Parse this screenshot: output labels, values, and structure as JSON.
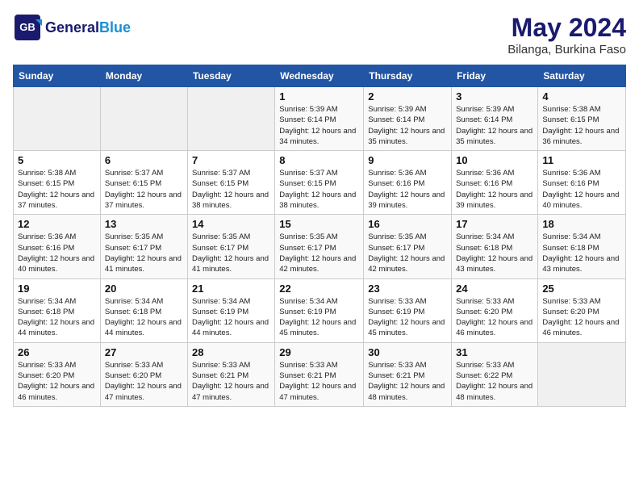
{
  "header": {
    "logo_general": "General",
    "logo_blue": "Blue",
    "month": "May 2024",
    "location": "Bilanga, Burkina Faso"
  },
  "weekdays": [
    "Sunday",
    "Monday",
    "Tuesday",
    "Wednesday",
    "Thursday",
    "Friday",
    "Saturday"
  ],
  "weeks": [
    [
      {
        "day": "",
        "sunrise": "",
        "sunset": "",
        "daylight": ""
      },
      {
        "day": "",
        "sunrise": "",
        "sunset": "",
        "daylight": ""
      },
      {
        "day": "",
        "sunrise": "",
        "sunset": "",
        "daylight": ""
      },
      {
        "day": "1",
        "sunrise": "Sunrise: 5:39 AM",
        "sunset": "Sunset: 6:14 PM",
        "daylight": "Daylight: 12 hours and 34 minutes."
      },
      {
        "day": "2",
        "sunrise": "Sunrise: 5:39 AM",
        "sunset": "Sunset: 6:14 PM",
        "daylight": "Daylight: 12 hours and 35 minutes."
      },
      {
        "day": "3",
        "sunrise": "Sunrise: 5:39 AM",
        "sunset": "Sunset: 6:14 PM",
        "daylight": "Daylight: 12 hours and 35 minutes."
      },
      {
        "day": "4",
        "sunrise": "Sunrise: 5:38 AM",
        "sunset": "Sunset: 6:15 PM",
        "daylight": "Daylight: 12 hours and 36 minutes."
      }
    ],
    [
      {
        "day": "5",
        "sunrise": "Sunrise: 5:38 AM",
        "sunset": "Sunset: 6:15 PM",
        "daylight": "Daylight: 12 hours and 37 minutes."
      },
      {
        "day": "6",
        "sunrise": "Sunrise: 5:37 AM",
        "sunset": "Sunset: 6:15 PM",
        "daylight": "Daylight: 12 hours and 37 minutes."
      },
      {
        "day": "7",
        "sunrise": "Sunrise: 5:37 AM",
        "sunset": "Sunset: 6:15 PM",
        "daylight": "Daylight: 12 hours and 38 minutes."
      },
      {
        "day": "8",
        "sunrise": "Sunrise: 5:37 AM",
        "sunset": "Sunset: 6:15 PM",
        "daylight": "Daylight: 12 hours and 38 minutes."
      },
      {
        "day": "9",
        "sunrise": "Sunrise: 5:36 AM",
        "sunset": "Sunset: 6:16 PM",
        "daylight": "Daylight: 12 hours and 39 minutes."
      },
      {
        "day": "10",
        "sunrise": "Sunrise: 5:36 AM",
        "sunset": "Sunset: 6:16 PM",
        "daylight": "Daylight: 12 hours and 39 minutes."
      },
      {
        "day": "11",
        "sunrise": "Sunrise: 5:36 AM",
        "sunset": "Sunset: 6:16 PM",
        "daylight": "Daylight: 12 hours and 40 minutes."
      }
    ],
    [
      {
        "day": "12",
        "sunrise": "Sunrise: 5:36 AM",
        "sunset": "Sunset: 6:16 PM",
        "daylight": "Daylight: 12 hours and 40 minutes."
      },
      {
        "day": "13",
        "sunrise": "Sunrise: 5:35 AM",
        "sunset": "Sunset: 6:17 PM",
        "daylight": "Daylight: 12 hours and 41 minutes."
      },
      {
        "day": "14",
        "sunrise": "Sunrise: 5:35 AM",
        "sunset": "Sunset: 6:17 PM",
        "daylight": "Daylight: 12 hours and 41 minutes."
      },
      {
        "day": "15",
        "sunrise": "Sunrise: 5:35 AM",
        "sunset": "Sunset: 6:17 PM",
        "daylight": "Daylight: 12 hours and 42 minutes."
      },
      {
        "day": "16",
        "sunrise": "Sunrise: 5:35 AM",
        "sunset": "Sunset: 6:17 PM",
        "daylight": "Daylight: 12 hours and 42 minutes."
      },
      {
        "day": "17",
        "sunrise": "Sunrise: 5:34 AM",
        "sunset": "Sunset: 6:18 PM",
        "daylight": "Daylight: 12 hours and 43 minutes."
      },
      {
        "day": "18",
        "sunrise": "Sunrise: 5:34 AM",
        "sunset": "Sunset: 6:18 PM",
        "daylight": "Daylight: 12 hours and 43 minutes."
      }
    ],
    [
      {
        "day": "19",
        "sunrise": "Sunrise: 5:34 AM",
        "sunset": "Sunset: 6:18 PM",
        "daylight": "Daylight: 12 hours and 44 minutes."
      },
      {
        "day": "20",
        "sunrise": "Sunrise: 5:34 AM",
        "sunset": "Sunset: 6:18 PM",
        "daylight": "Daylight: 12 hours and 44 minutes."
      },
      {
        "day": "21",
        "sunrise": "Sunrise: 5:34 AM",
        "sunset": "Sunset: 6:19 PM",
        "daylight": "Daylight: 12 hours and 44 minutes."
      },
      {
        "day": "22",
        "sunrise": "Sunrise: 5:34 AM",
        "sunset": "Sunset: 6:19 PM",
        "daylight": "Daylight: 12 hours and 45 minutes."
      },
      {
        "day": "23",
        "sunrise": "Sunrise: 5:33 AM",
        "sunset": "Sunset: 6:19 PM",
        "daylight": "Daylight: 12 hours and 45 minutes."
      },
      {
        "day": "24",
        "sunrise": "Sunrise: 5:33 AM",
        "sunset": "Sunset: 6:20 PM",
        "daylight": "Daylight: 12 hours and 46 minutes."
      },
      {
        "day": "25",
        "sunrise": "Sunrise: 5:33 AM",
        "sunset": "Sunset: 6:20 PM",
        "daylight": "Daylight: 12 hours and 46 minutes."
      }
    ],
    [
      {
        "day": "26",
        "sunrise": "Sunrise: 5:33 AM",
        "sunset": "Sunset: 6:20 PM",
        "daylight": "Daylight: 12 hours and 46 minutes."
      },
      {
        "day": "27",
        "sunrise": "Sunrise: 5:33 AM",
        "sunset": "Sunset: 6:20 PM",
        "daylight": "Daylight: 12 hours and 47 minutes."
      },
      {
        "day": "28",
        "sunrise": "Sunrise: 5:33 AM",
        "sunset": "Sunset: 6:21 PM",
        "daylight": "Daylight: 12 hours and 47 minutes."
      },
      {
        "day": "29",
        "sunrise": "Sunrise: 5:33 AM",
        "sunset": "Sunset: 6:21 PM",
        "daylight": "Daylight: 12 hours and 47 minutes."
      },
      {
        "day": "30",
        "sunrise": "Sunrise: 5:33 AM",
        "sunset": "Sunset: 6:21 PM",
        "daylight": "Daylight: 12 hours and 48 minutes."
      },
      {
        "day": "31",
        "sunrise": "Sunrise: 5:33 AM",
        "sunset": "Sunset: 6:22 PM",
        "daylight": "Daylight: 12 hours and 48 minutes."
      },
      {
        "day": "",
        "sunrise": "",
        "sunset": "",
        "daylight": ""
      }
    ]
  ]
}
